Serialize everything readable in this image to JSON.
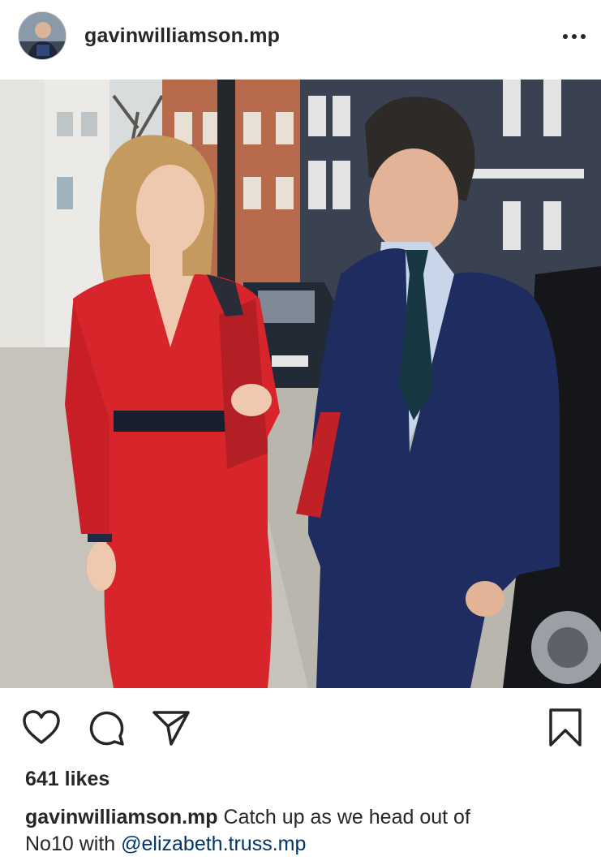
{
  "post": {
    "username": "gavinwilliamson.mp",
    "likes": "641 likes",
    "caption": {
      "username": "gavinwilliamson.mp",
      "text_line1": "Catch up as we head out of",
      "text_line2": "No10 with",
      "mention": "@elizabeth.truss.mp"
    }
  },
  "icons": {
    "avatar": "profile-photo",
    "more": "more-options-icon",
    "like": "heart-icon",
    "comment": "comment-bubble-icon",
    "share": "paper-plane-icon",
    "save": "bookmark-icon"
  },
  "colors": {
    "text": "#262626",
    "mention": "#003569",
    "red_dress": "#d8242b",
    "navy_suit": "#1f2c5f"
  }
}
